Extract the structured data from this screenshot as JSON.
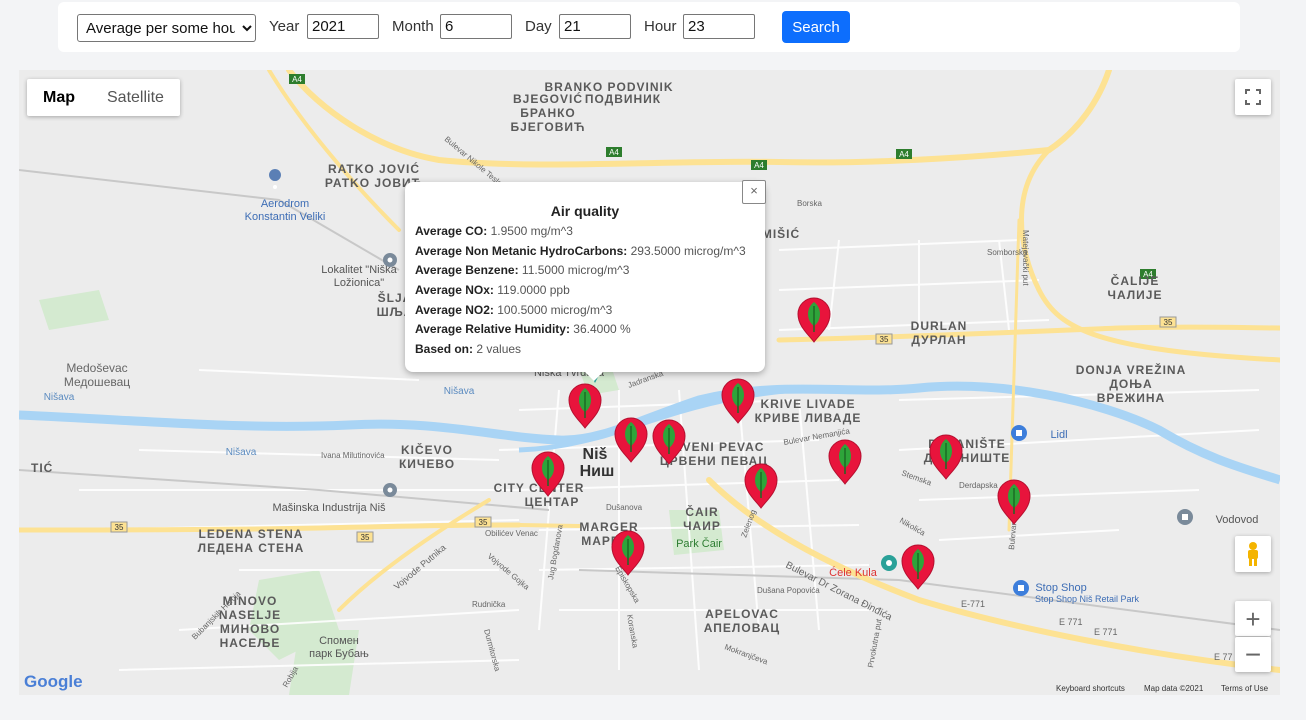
{
  "toolbar": {
    "mode_selected": "Average per some hour",
    "year_label": "Year",
    "year_value": "2021",
    "month_label": "Month",
    "month_value": "6",
    "day_label": "Day",
    "day_value": "21",
    "hour_label": "Hour",
    "hour_value": "23",
    "search_label": "Search"
  },
  "map": {
    "type_map": "Map",
    "type_satellite": "Satellite",
    "labels": {
      "branko_lat": "BRANKO PODVINIK",
      "branko_lat2": "BJEGOVIĆ",
      "branko_cyr": "ПОДВИНИК",
      "branko_cyr2": "БРАНКО",
      "branko_cyr3": "БЈЕГОВИЋ",
      "ratko_lat": "RATKO JOVIĆ",
      "ratko_cyr": "PATKO JOBИЋ",
      "aerodrom": "Aerodrom",
      "aerodrom2": "Konstantin Veliki",
      "lokalitet": "Lokalitet \"Niška",
      "lokalitet2": "Ložionica\"",
      "sljaka": "ŠLJA",
      "sljaka_cyr": "ШЉА",
      "misic": "MIŠIĆ",
      "durlan": "DURLAN",
      "durlan_cyr": "ДУРЛАН",
      "calije": "ČALIJE",
      "calije_cyr": "ЧАЛИЈЕ",
      "medosevac": "Medoševac",
      "medosevac_cyr": "Медошевац",
      "nisava": "Nišava",
      "krive": "KRIVE LIVADE",
      "krive_cyr": "КРИВЕ ЛИВАДЕ",
      "donja": "DONJA VREŽINA",
      "donja_cyr": "ДОЊА",
      "donja_cyr2": "ВРЕЖИНА",
      "kicevo": "KIČEVO",
      "kicevo_cyr": "КИЧЕВО",
      "nis": "Niš",
      "nis_cyr": "Ниш",
      "crveni": "CRVENI PEVAC",
      "crveni_cyr": "ЦРВЕНИ ПЕВАЦ",
      "city_center": "CITY CENTER",
      "city_center_cyr": "ЦЕНТАР",
      "masinska": "Mašinska Industrija Niš",
      "ledena": "LEDENA STENA",
      "ledena_cyr": "ЛЕДЕНА СТЕНА",
      "marger": "MARGER",
      "marger_cyr": "МАРГЕР",
      "cair": "ČAIR",
      "cair_cyr": "ЧАИР",
      "park_cair": "Park Čair",
      "duvaniste": "DUVANIŠTE",
      "duvaniste_cyr": "ДУВАНИШТЕ",
      "lidl": "Lidl",
      "vodovod": "Vodovod",
      "cele_kula": "Ćele Kula",
      "stop_shop": "Stop Shop",
      "stop_shop2": "Stop Shop Niš Retail Park",
      "minovo": "MINOVO",
      "minovo2": "NASELJE",
      "minovo_cyr": "МИНОВО",
      "minovo_cyr2": "НАСЕЉЕ",
      "apelovac": "APELOVAC",
      "apelovac_cyr": "АПЕЛОВАЦ",
      "spomen": "Спомен",
      "spomen2": "парк Бубањ",
      "niska_tvrdava": "Niška Tvrđava",
      "bulevar_zoran": "Bulevar Dr Zorana Đinđića",
      "vojvode": "Vojvode Putnika",
      "tic": "TIĆ",
      "a4": "A4",
      "r35": "35",
      "e771": "E-771",
      "e771b": "E 771",
      "e771c": "E 771",
      "e771d": "E 77",
      "bulevar_nikole": "Bulevar Nikole Tesle",
      "borska": "Borska",
      "somborska": "Somborska",
      "matejevacki": "Matejevački put",
      "jadranska": "Jadranska",
      "ivana": "Ivana Milutinovića",
      "dusanova": "Dušanova",
      "dusanova2": "Dušana Popovića",
      "obilicev": "Obilićev Venac",
      "vojvode_gojka": "Vojvode Gojka",
      "jug": "Jug Bogdanova",
      "episkopska": "Episkopska",
      "rudnicka": "Rudnička",
      "durmitorska": "Durmitorska",
      "koranska": "Koranska",
      "mokranjceva": "Mokranjčeva",
      "bubanjskih": "Bubanjskih Heroja",
      "robija": "Robija",
      "zeleva": "Zelenog",
      "stemska": "Stemska",
      "nemanjica": "Bulevar Nemanjića",
      "derdapska": "Derdapska",
      "bulevar_med": "Bulevar Medijana",
      "nikolica": "Nikolića",
      "prvomajska": "Prvokutna put"
    },
    "footer_shortcuts": "Keyboard shortcuts",
    "footer_data": "Map data ©2021",
    "footer_terms": "Terms of Use",
    "google": "Google"
  },
  "popup": {
    "title": "Air quality",
    "rows": [
      {
        "label": "Average CO:",
        "value": "1.9500 mg/m^3"
      },
      {
        "label": "Average Non Metanic HydroCarbons:",
        "value": "293.5000 microg/m^3"
      },
      {
        "label": "Average Benzene:",
        "value": "11.5000 microg/m^3"
      },
      {
        "label": "Average NOx:",
        "value": "119.0000 ppb"
      },
      {
        "label": "Average NO2:",
        "value": "100.5000 microg/m^3"
      },
      {
        "label": "Average Relative Humidity:",
        "value": "36.4000 %"
      },
      {
        "label": "Based on:",
        "value": "2 values"
      }
    ],
    "close": "×"
  },
  "colors": {
    "marker": "#e8143c",
    "marker_leaf": "#2ea43a",
    "road_major": "#fde293",
    "river": "#a9d4f5",
    "park": "#cde8c8",
    "accent": "#0d6efd"
  }
}
